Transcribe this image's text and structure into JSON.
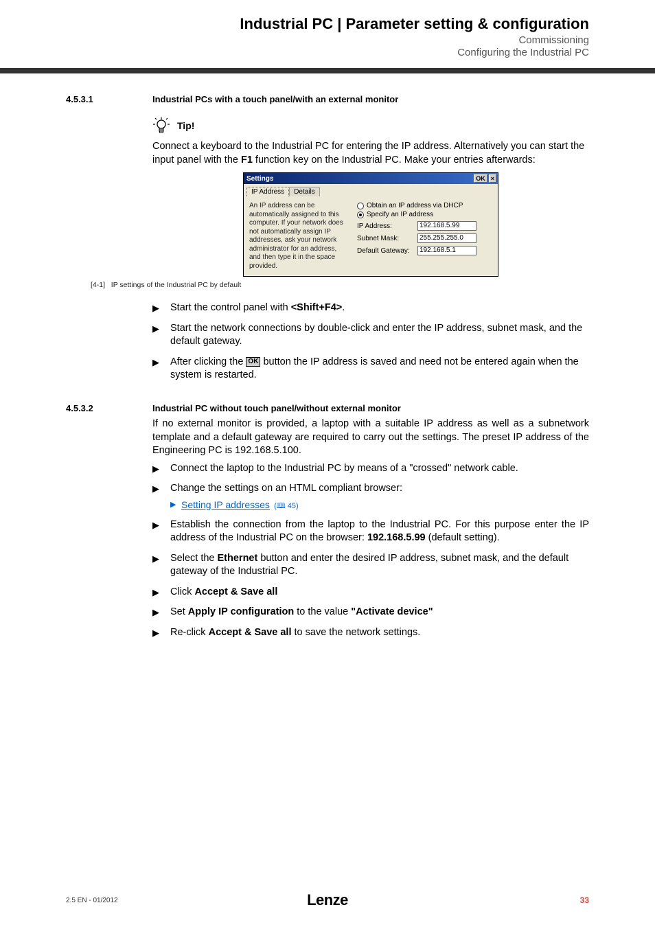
{
  "header": {
    "title": "Industrial PC | Parameter setting & configuration",
    "sub1": "Commissioning",
    "sub2": "Configuring the Industrial PC"
  },
  "section1": {
    "num": "4.5.3.1",
    "title": "Industrial PCs with a touch panel/with an external monitor",
    "tip_label": "Tip!",
    "tip_body": "Connect a keyboard to the Industrial PC for entering the IP address. Alternatively you can start the input panel with the ",
    "tip_body_bold": "F1",
    "tip_body_after": " function key on the Industrial PC. Make your entries afterwards:"
  },
  "dialog": {
    "title": "Settings",
    "ok": "OK",
    "close": "×",
    "tab1": "IP Address",
    "tab2": "Details",
    "left_text": "An IP address can be automatically assigned to this computer. If your network does not automatically assign IP addresses, ask your network administrator for an address, and then type it in the space provided.",
    "radio_dhcp": "Obtain an IP address via DHCP",
    "radio_specify": "Specify an IP address",
    "ip_label": "IP Address:",
    "ip_value": "192.168.5.99",
    "mask_label": "Subnet Mask:",
    "mask_value": "255.255.255.0",
    "gw_label": "Default Gateway:",
    "gw_value": "192.168.5.1"
  },
  "caption": {
    "num": "[4-1]",
    "text": "IP settings of the Industrial PC by default"
  },
  "bullets1": {
    "b1_pre": "Start the control panel with ",
    "b1_bold": "<Shift+F4>",
    "b1_post": ".",
    "b2": "Start the network connections by double-click and enter the IP address, subnet mask, and the default gateway.",
    "b3_pre": "After clicking the ",
    "b3_ok": "OK",
    "b3_post": " button the IP address is saved and need not be entered again when the system is restarted."
  },
  "section2": {
    "num": "4.5.3.2",
    "title": "Industrial PC without touch panel/without external monitor",
    "intro": "If no external monitor is provided, a laptop with a suitable IP address as well as a subnetwork template and a default gateway are required to carry out the settings. The preset IP address of the Engineering PC is 192.168.5.100."
  },
  "bullets2": {
    "b1": "Connect the laptop to the Industrial PC by means of a \"crossed\" network cable.",
    "b2": "Change the settings on an HTML compliant browser:",
    "b2_link": "Setting IP addresses",
    "b2_ref": "(🕮 45)",
    "b3_pre": "Establish the connection from the laptop to the Industrial PC. For this purpose enter the IP address of the Industrial PC on the browser: ",
    "b3_bold": "192.168.5.99",
    "b3_post": " (default setting).",
    "b4_pre": "Select the ",
    "b4_bold": "Ethernet",
    "b4_post": "  button and enter the desired IP address, subnet mask, and the default gateway of the Industrial PC.",
    "b5_pre": "Click ",
    "b5_bold": "Accept & Save all",
    "b6_pre": "Set ",
    "b6_bold1": "Apply IP configuration",
    "b6_mid": " to the value ",
    "b6_bold2": "\"Activate device\"",
    "b7_pre": "Re-click ",
    "b7_bold": "Accept & Save all",
    "b7_post": " to save the network settings."
  },
  "footer": {
    "left": "2.5 EN - 01/2012",
    "logo": "Lenze",
    "page": "33"
  }
}
